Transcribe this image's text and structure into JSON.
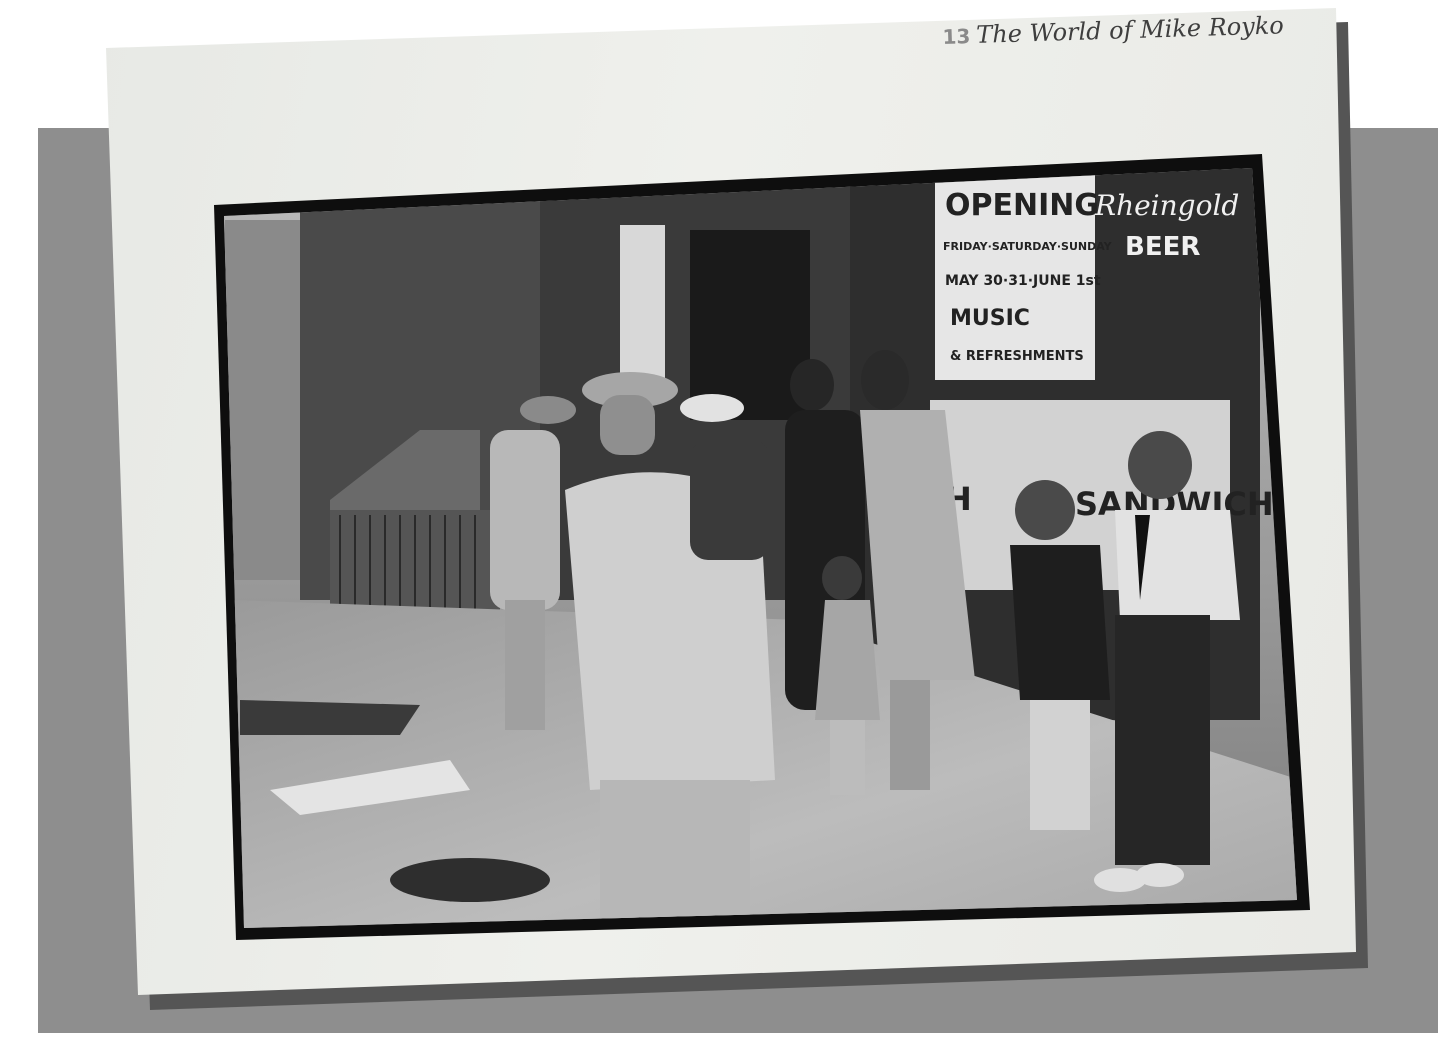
{
  "page_header": {
    "chapter_number": "13",
    "chapter_title": "The World of Mike Royko"
  },
  "photo_signs": {
    "opening_line1": "OPENING",
    "opening_line2": "FRIDAY·SATURDAY·SUNDAY",
    "opening_line3": "MAY 30·31·JUNE 1st",
    "opening_line4": "MUSIC",
    "opening_line5": "& REFRESHMENTS",
    "neon_brand": "Rheingold",
    "neon_beer": "BEER",
    "window_left": "H",
    "window_right": "SANDWICHES"
  },
  "colors": {
    "shadow_slab": "#8e8e8e",
    "page": "#eeefeb",
    "photo_border": "#0e0e0e"
  }
}
